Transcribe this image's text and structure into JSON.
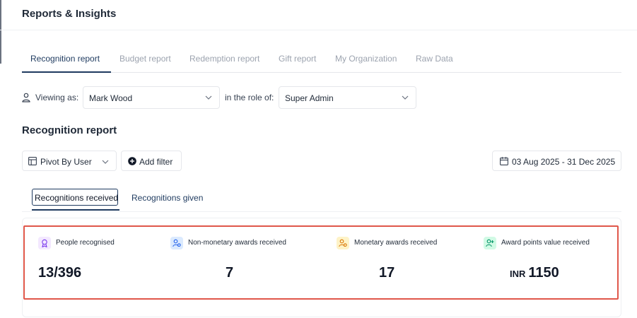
{
  "header": {
    "title": "Reports & Insights"
  },
  "tabs": [
    {
      "label": "Recognition report",
      "active": true
    },
    {
      "label": "Budget report"
    },
    {
      "label": "Redemption report"
    },
    {
      "label": "Gift report"
    },
    {
      "label": "My Organization"
    },
    {
      "label": "Raw Data"
    }
  ],
  "viewing": {
    "label": "Viewing as:",
    "user": "Mark Wood",
    "role_label": "in the role of:",
    "role": "Super Admin"
  },
  "section": {
    "title": "Recognition report"
  },
  "toolbar": {
    "pivot_label": "Pivot By User",
    "add_filter_label": "Add filter",
    "date_range": "03 Aug 2025 - 31 Dec 2025"
  },
  "subtabs": {
    "received": "Recognitions received",
    "given": "Recognitions given"
  },
  "metrics": [
    {
      "label": "People recognised",
      "value": "13/396",
      "icon": "award-icon",
      "color": "#7c3aed",
      "bg": "#f3e8ff"
    },
    {
      "label": "Non-monetary awards received",
      "value": "7",
      "icon": "users-icon",
      "color": "#2563eb",
      "bg": "#dbeafe"
    },
    {
      "label": "Monetary awards received",
      "value": "17",
      "icon": "users-icon",
      "color": "#d97706",
      "bg": "#fef3c7"
    },
    {
      "label": "Award points value received",
      "prefix": "INR",
      "value": "1150",
      "icon": "user-plus-icon",
      "color": "#059669",
      "bg": "#d1fae5"
    }
  ],
  "colors": {
    "accent": "#1e3a5f",
    "highlight": "#e0574a"
  }
}
